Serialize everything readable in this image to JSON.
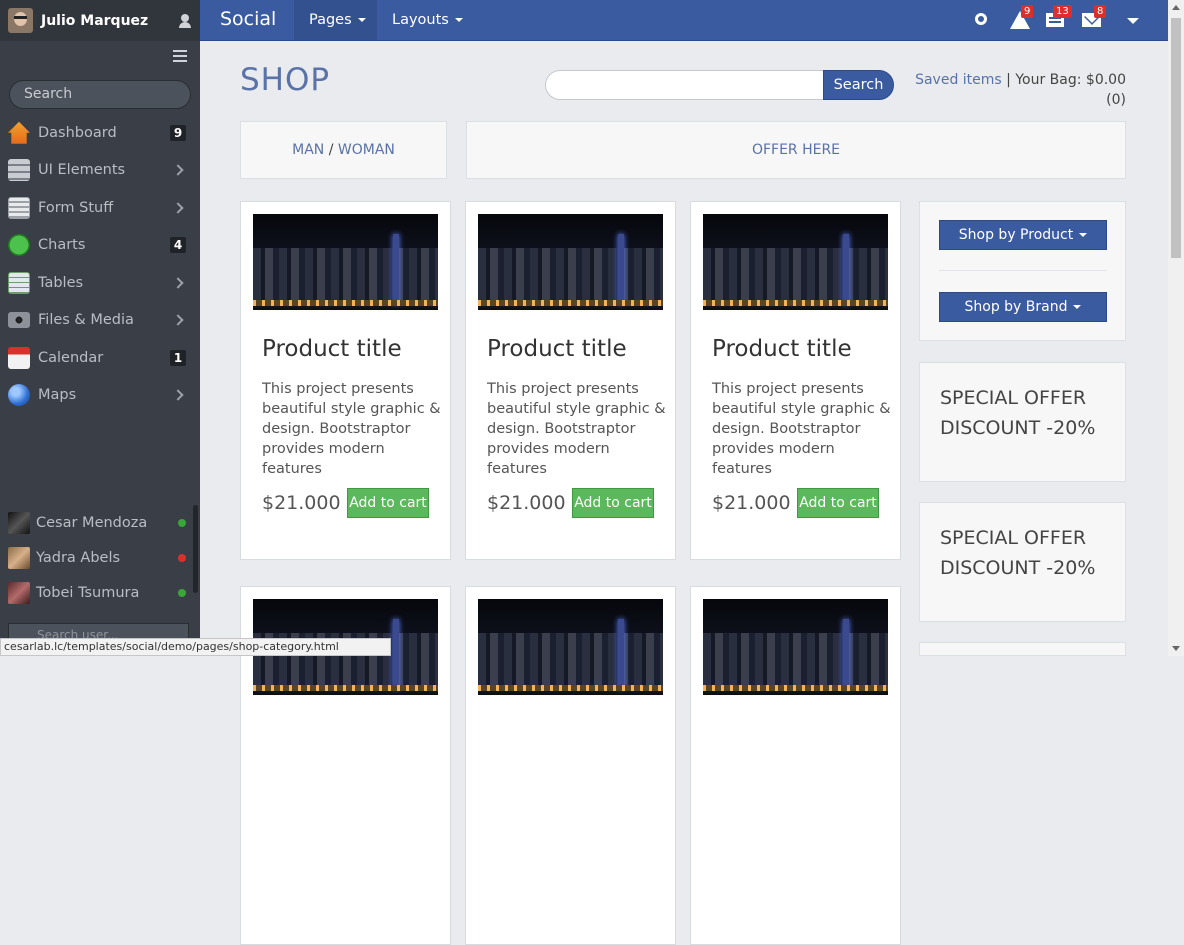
{
  "user": {
    "name": "Julio Marquez"
  },
  "sidebar": {
    "search_placeholder": "Search",
    "items": [
      {
        "label": "Dashboard",
        "badge": "9",
        "icon": "home-icon"
      },
      {
        "label": "UI Elements",
        "icon": "ui-elements-icon"
      },
      {
        "label": "Form Stuff",
        "icon": "form-icon"
      },
      {
        "label": "Charts",
        "badge": "4",
        "icon": "chart-icon"
      },
      {
        "label": "Tables",
        "icon": "table-icon"
      },
      {
        "label": "Files & Media",
        "icon": "camera-icon"
      },
      {
        "label": "Calendar",
        "badge": "1",
        "icon": "calendar-icon"
      },
      {
        "label": "Maps",
        "icon": "globe-icon"
      }
    ],
    "contacts": [
      {
        "name": "Cesar Mendoza",
        "status_color": "#3aa63a"
      },
      {
        "name": "Yadra Abels",
        "status_color": "#d9302c"
      },
      {
        "name": "Tobei Tsumura",
        "status_color": "#3aa63a"
      }
    ],
    "search_user_placeholder": "Search user..."
  },
  "topbar": {
    "brand": "Social",
    "nav": [
      {
        "label": "Pages"
      },
      {
        "label": "Layouts"
      }
    ],
    "alerts_count": "9",
    "news_count": "13",
    "mail_count": "8"
  },
  "shop": {
    "title": "SHOP",
    "search_button": "Search",
    "saved_items": "Saved items",
    "bag": "Your Bag: $0.00",
    "bag_count": "(0)",
    "banner_man": "MAN",
    "banner_sep": "/",
    "banner_woman": "WOMAN",
    "offer_here": "OFFER HERE",
    "shop_by_product": "Shop by Product",
    "shop_by_brand": "Shop by Brand",
    "special_offer_1": [
      "SPECIAL OFFER",
      "DISCOUNT -20%"
    ],
    "special_offer_2": [
      "SPECIAL OFFER",
      "DISCOUNT -20%"
    ]
  },
  "products": [
    {
      "title": "Product title",
      "description": "This project presents beautiful style graphic & design. Bootstraptor provides modern features",
      "price": "$21.000",
      "button": "Add to cart"
    },
    {
      "title": "Product title",
      "description": "This project presents beautiful style graphic & design. Bootstraptor provides modern features",
      "price": "$21.000",
      "button": "Add to cart"
    },
    {
      "title": "Product title",
      "description": "This project presents beautiful style graphic & design. Bootstraptor provides modern features",
      "price": "$21.000",
      "button": "Add to cart"
    }
  ],
  "status_url": "cesarlab.lc/templates/social/demo/pages/shop-category.html"
}
